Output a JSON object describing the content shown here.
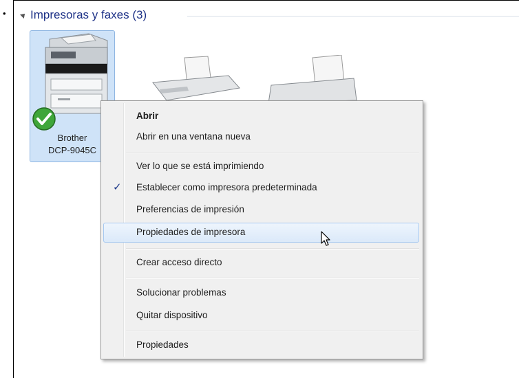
{
  "group": {
    "title": "Impresoras y faxes (3)"
  },
  "devices": [
    {
      "name_line1": "Brother",
      "name_line2": "DCP-9045C"
    }
  ],
  "context_menu": {
    "items": [
      {
        "label": "Abrir"
      },
      {
        "label": "Abrir en una ventana nueva"
      },
      {
        "label": "Ver lo que se está imprimiendo"
      },
      {
        "label": "Establecer como impresora predeterminada"
      },
      {
        "label": "Preferencias de impresión"
      },
      {
        "label": "Propiedades de impresora"
      },
      {
        "label": "Crear acceso directo"
      },
      {
        "label": "Solucionar problemas"
      },
      {
        "label": "Quitar dispositivo"
      },
      {
        "label": "Propiedades"
      }
    ],
    "check_glyph": "✓"
  }
}
